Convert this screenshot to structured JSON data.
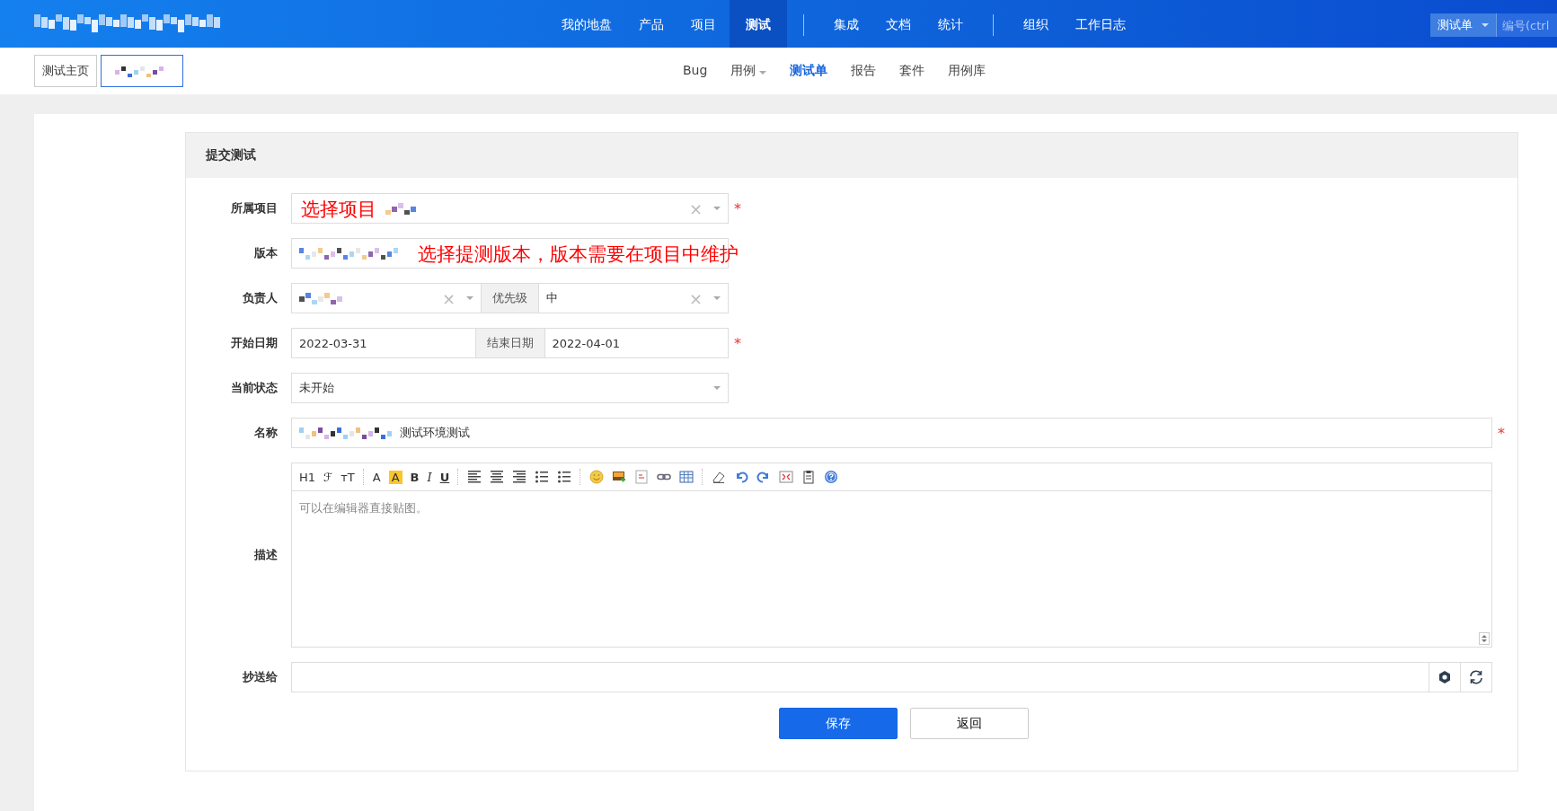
{
  "top_nav": {
    "items": [
      {
        "label": "我的地盘",
        "selected": false
      },
      {
        "label": "产品",
        "selected": false
      },
      {
        "label": "项目",
        "selected": false
      },
      {
        "label": "测试",
        "selected": true
      },
      {
        "kind": "divider"
      },
      {
        "label": "集成",
        "selected": false
      },
      {
        "label": "文档",
        "selected": false
      },
      {
        "label": "统计",
        "selected": false
      },
      {
        "kind": "divider"
      },
      {
        "label": "组织",
        "selected": false
      },
      {
        "label": "工作日志",
        "selected": false
      }
    ],
    "search": {
      "type": "测试单",
      "placeholder": "编号(ctrl"
    }
  },
  "breadcrumb": {
    "home": "测试主页"
  },
  "sub_nav": [
    {
      "label": "Bug",
      "selected": false,
      "dropdown": false
    },
    {
      "label": "用例",
      "selected": false,
      "dropdown": true
    },
    {
      "label": "测试单",
      "selected": true,
      "dropdown": false
    },
    {
      "label": "报告",
      "selected": false,
      "dropdown": false
    },
    {
      "label": "套件",
      "selected": false,
      "dropdown": false
    },
    {
      "label": "用例库",
      "selected": false,
      "dropdown": false
    }
  ],
  "form": {
    "title": "提交测试",
    "project": {
      "label": "所属项目",
      "clear": "×",
      "required_mark": "*",
      "annotation": "选择项目"
    },
    "build": {
      "label": "版本",
      "annotation": "选择提测版本，版本需要在项目中维护"
    },
    "owner": {
      "label": "负责人",
      "clear": "×",
      "priority_label": "优先级",
      "priority": "中",
      "priority_clear": "×"
    },
    "dates": {
      "label": "开始日期",
      "begin": "2022-03-31",
      "end_label": "结束日期",
      "end": "2022-04-01",
      "required_mark": "*"
    },
    "status": {
      "label": "当前状态",
      "value": "未开始"
    },
    "name": {
      "label": "名称",
      "value": "测试环境测试",
      "required_mark": "*"
    },
    "description": {
      "label": "描述",
      "placeholder": "可以在编辑器直接贴图。",
      "toolbar": [
        {
          "kind": "text",
          "text": "H1"
        },
        {
          "kind": "text",
          "text": "ℱ"
        },
        {
          "kind": "text",
          "text": "ᴛT"
        },
        {
          "kind": "sep"
        },
        {
          "kind": "text",
          "text": "A"
        },
        {
          "kind": "highlight",
          "text": "A"
        },
        {
          "kind": "bold",
          "text": "B"
        },
        {
          "kind": "italic",
          "text": "I"
        },
        {
          "kind": "underline",
          "text": "U"
        },
        {
          "kind": "sep"
        },
        {
          "kind": "align-left"
        },
        {
          "kind": "align-center"
        },
        {
          "kind": "align-right"
        },
        {
          "kind": "ordered-list"
        },
        {
          "kind": "bullet-list"
        },
        {
          "kind": "sep"
        },
        {
          "kind": "emoji"
        },
        {
          "kind": "image"
        },
        {
          "kind": "code"
        },
        {
          "kind": "link"
        },
        {
          "kind": "table"
        },
        {
          "kind": "sep"
        },
        {
          "kind": "eraser"
        },
        {
          "kind": "undo"
        },
        {
          "kind": "redo"
        },
        {
          "kind": "fullscreen"
        },
        {
          "kind": "paste"
        },
        {
          "kind": "help"
        }
      ]
    },
    "mailto": {
      "label": "抄送给"
    },
    "buttons": [
      {
        "label": "保存",
        "kind": "primary"
      },
      {
        "label": "返回",
        "kind": "default"
      }
    ]
  }
}
